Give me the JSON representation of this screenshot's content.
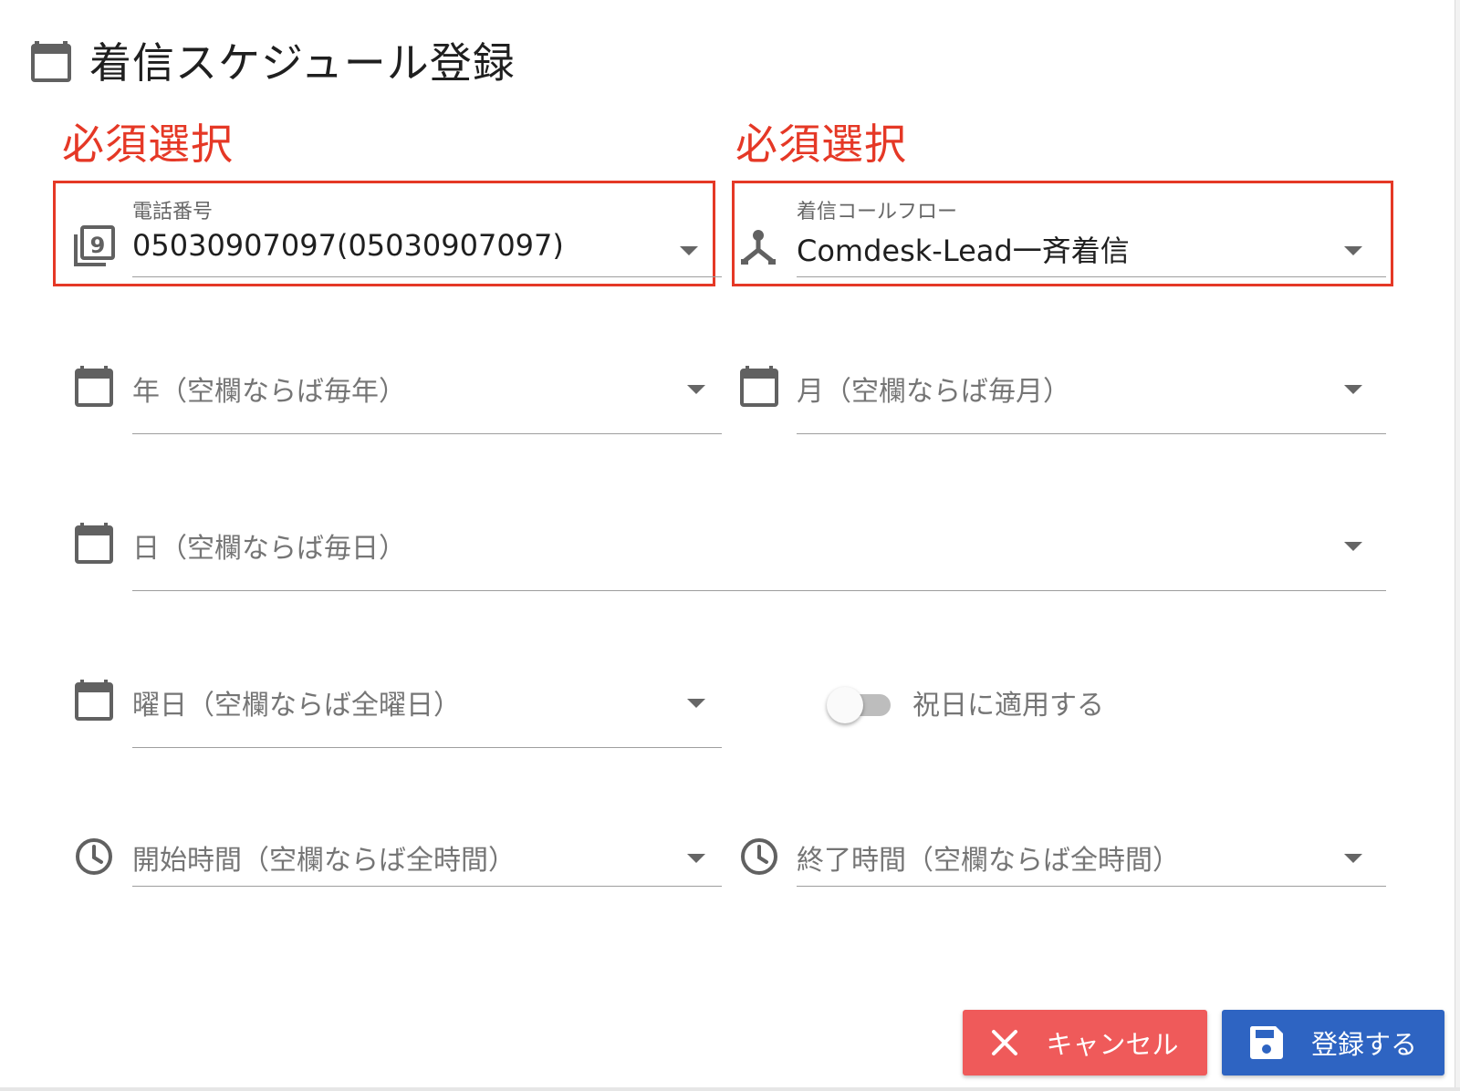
{
  "title": "着信スケジュール登録",
  "required_label_left": "必須選択",
  "required_label_right": "必須選択",
  "phone_field": {
    "label": "電話番号",
    "value": "05030907097(05030907097)"
  },
  "flow_field": {
    "label": "着信コールフロー",
    "value": "Comdesk-Lead一斉着信"
  },
  "year_field": {
    "placeholder": "年（空欄ならば毎年）"
  },
  "month_field": {
    "placeholder": "月（空欄ならば毎月）"
  },
  "day_field": {
    "placeholder": "日（空欄ならば毎日）"
  },
  "weekday_field": {
    "placeholder": "曜日（空欄ならば全曜日）"
  },
  "holiday_toggle": {
    "label": "祝日に適用する",
    "on": false
  },
  "start_time_field": {
    "placeholder": "開始時間（空欄ならば全時間）"
  },
  "end_time_field": {
    "placeholder": "終了時間（空欄ならば全時間）"
  },
  "buttons": {
    "cancel_label": "キャンセル",
    "save_label": "登録する"
  },
  "colors": {
    "required_red": "#e53826",
    "cancel_bg": "#ef5a5a",
    "save_bg": "#2e64c2"
  },
  "icons": {
    "title": "calendar-icon",
    "phone": "dialpad-number-icon",
    "flow": "call-split-icon",
    "date": "calendar-icon",
    "time": "clock-icon",
    "cancel": "close-icon",
    "save": "floppy-disk-icon"
  }
}
